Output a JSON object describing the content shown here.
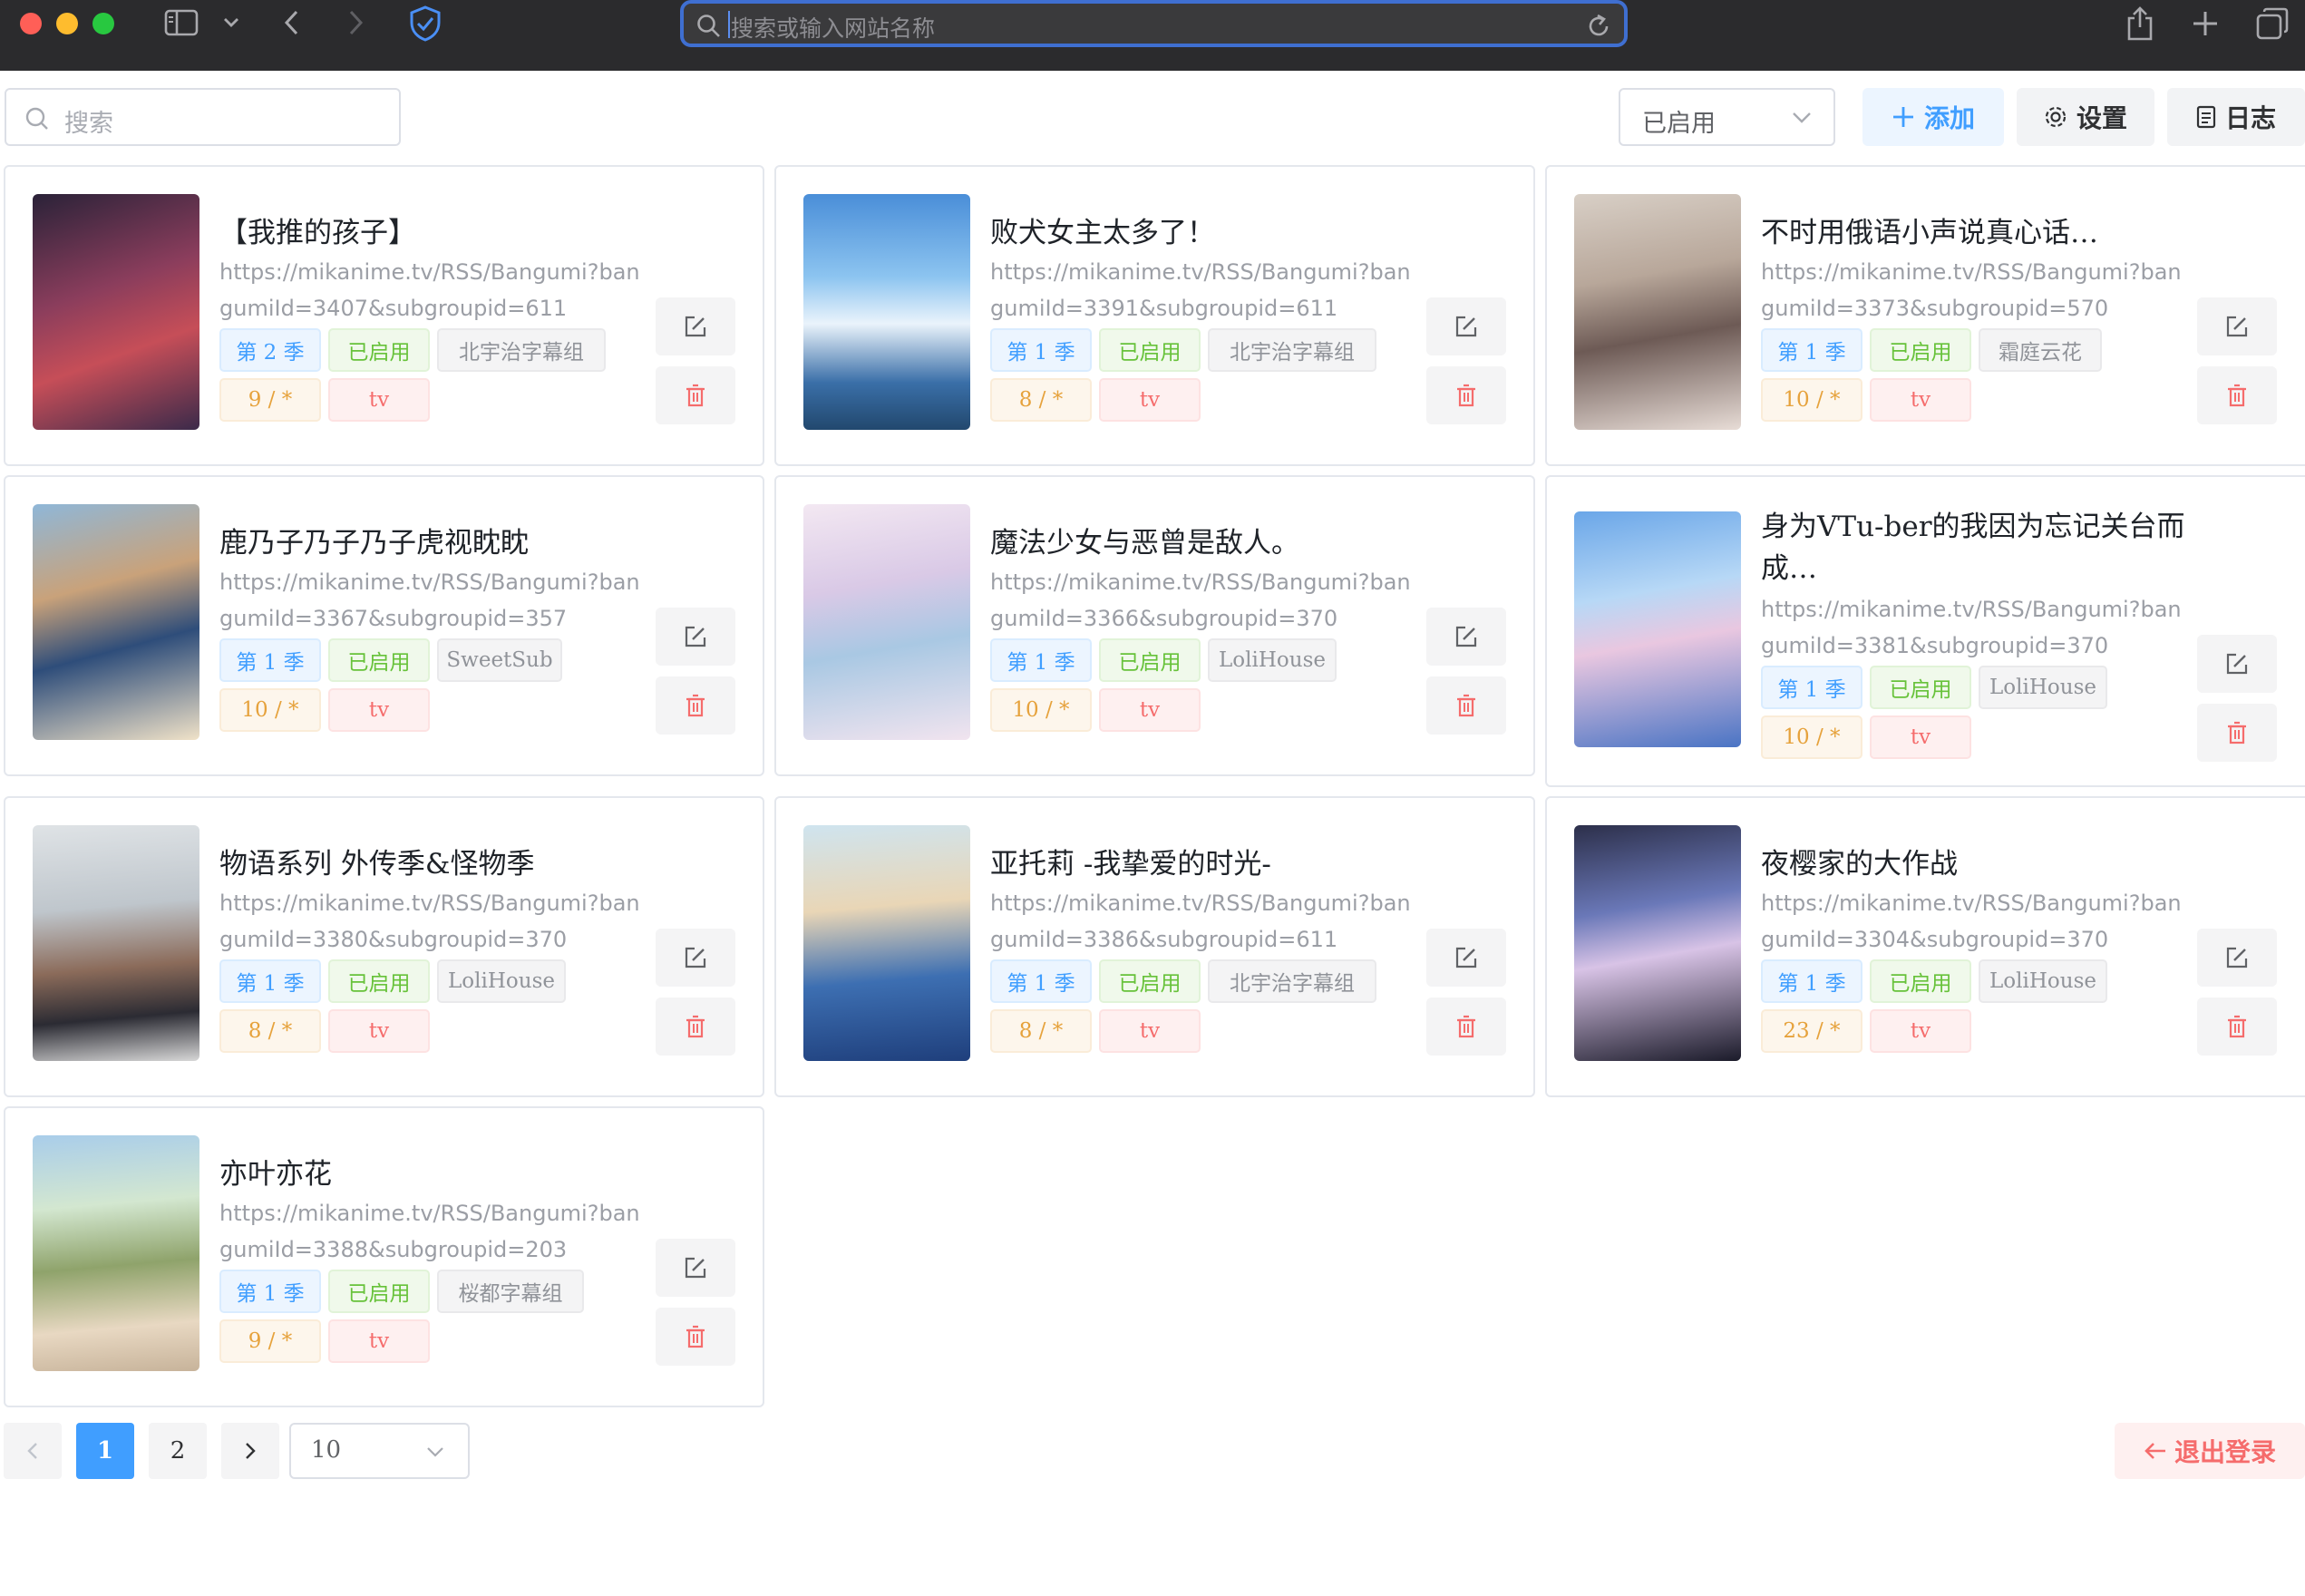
{
  "browser": {
    "address_placeholder": "搜索或输入网站名称"
  },
  "toolbar": {
    "search_placeholder": "搜索",
    "status_select": "已启用",
    "add_label": "添加",
    "settings_label": "设置",
    "log_label": "日志"
  },
  "cards": [
    {
      "title": "【我推的孩子】",
      "url": "https://mikanime.tv/RSS/Bangumi?bangumiId=3407&subgroupid=611",
      "season": "第 2 季",
      "status": "已启用",
      "group": "北宇治字幕组",
      "episodes": "9 / *",
      "type": "tv"
    },
    {
      "title": "败犬女主太多了！",
      "url": "https://mikanime.tv/RSS/Bangumi?bangumiId=3391&subgroupid=611",
      "season": "第 1 季",
      "status": "已启用",
      "group": "北宇治字幕组",
      "episodes": "8 / *",
      "type": "tv"
    },
    {
      "title": "不时用俄语小声说真心话…",
      "url": "https://mikanime.tv/RSS/Bangumi?bangumiId=3373&subgroupid=570",
      "season": "第 1 季",
      "status": "已启用",
      "group": "霜庭云花",
      "episodes": "10 / *",
      "type": "tv"
    },
    {
      "title": "鹿乃子乃子乃子虎视眈眈",
      "url": "https://mikanime.tv/RSS/Bangumi?bangumiId=3367&subgroupid=357",
      "season": "第 1 季",
      "status": "已启用",
      "group": "SweetSub",
      "episodes": "10 / *",
      "type": "tv"
    },
    {
      "title": "魔法少女与恶曾是敌人。",
      "url": "https://mikanime.tv/RSS/Bangumi?bangumiId=3366&subgroupid=370",
      "season": "第 1 季",
      "status": "已启用",
      "group": "LoliHouse",
      "episodes": "10 / *",
      "type": "tv"
    },
    {
      "title": "身为VTu-ber的我因为忘记关台而成…",
      "url": "https://mikanime.tv/RSS/Bangumi?bangumiId=3381&subgroupid=370",
      "season": "第 1 季",
      "status": "已启用",
      "group": "LoliHouse",
      "episodes": "10 / *",
      "type": "tv"
    },
    {
      "title": "物语系列 外传季&怪物季",
      "url": "https://mikanime.tv/RSS/Bangumi?bangumiId=3380&subgroupid=370",
      "season": "第 1 季",
      "status": "已启用",
      "group": "LoliHouse",
      "episodes": "8 / *",
      "type": "tv"
    },
    {
      "title": "亚托莉 -我挚爱的时光-",
      "url": "https://mikanime.tv/RSS/Bangumi?bangumiId=3386&subgroupid=611",
      "season": "第 1 季",
      "status": "已启用",
      "group": "北宇治字幕组",
      "episodes": "8 / *",
      "type": "tv"
    },
    {
      "title": "夜樱家的大作战",
      "url": "https://mikanime.tv/RSS/Bangumi?bangumiId=3304&subgroupid=370",
      "season": "第 1 季",
      "status": "已启用",
      "group": "LoliHouse",
      "episodes": "23 / *",
      "type": "tv"
    },
    {
      "title": "亦叶亦花",
      "url": "https://mikanime.tv/RSS/Bangumi?bangumiId=3388&subgroupid=203",
      "season": "第 1 季",
      "status": "已启用",
      "group": "桜都字幕组",
      "episodes": "9 / *",
      "type": "tv"
    }
  ],
  "pagination": {
    "page1": "1",
    "page2": "2",
    "page_size": "10"
  },
  "logout_label": "退出登录",
  "colors": {
    "primary": "#409eff",
    "success": "#67c23a",
    "warning": "#e6a23c",
    "danger": "#f56c6c"
  }
}
